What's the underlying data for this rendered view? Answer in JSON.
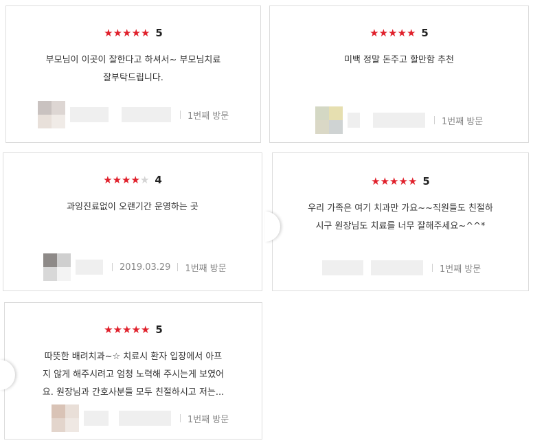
{
  "reviews": [
    {
      "stars": "★★★★★",
      "stars_empty": "",
      "score": "5",
      "lines": [
        "부모님이 이곳이 잘한다고 하셔서~ 부모님치료",
        "잘부탁드립니다."
      ],
      "date": "",
      "visit": "1번째 방문"
    },
    {
      "stars": "★★★★★",
      "stars_empty": "",
      "score": "5",
      "lines": [
        "미백 정말 돈주고 할만함 추천"
      ],
      "date": "",
      "visit": "1번째 방문"
    },
    {
      "stars": "★★★★",
      "stars_empty": "★",
      "score": "4",
      "lines": [
        "과잉진료없이 오랜기간 운영하는 곳"
      ],
      "date": "2019.03.29",
      "visit": "1번째 방문"
    },
    {
      "stars": "★★★★★",
      "stars_empty": "",
      "score": "5",
      "lines": [
        "우리 가족은 여기 치과만 가요~~직원들도 친절하",
        "시구 원장님도 치료를 너무 잘해주세요~^^*"
      ],
      "date": "",
      "visit": "1번째 방문"
    },
    {
      "stars": "★★★★★",
      "stars_empty": "",
      "score": "5",
      "lines": [
        "따뜻한 배려치과~☆ 치료시 환자 입장에서 아프",
        "지 않게 해주시려고 엄청 노력해 주시는게 보였어",
        "요. 원장님과 간호사분들 모두 친절하시고 저는..."
      ],
      "date": "",
      "visit": "1번째 방문"
    }
  ],
  "colors": {
    "star": "#e0202b",
    "star_empty": "#d4d4d4",
    "border": "#dcdcdc"
  }
}
